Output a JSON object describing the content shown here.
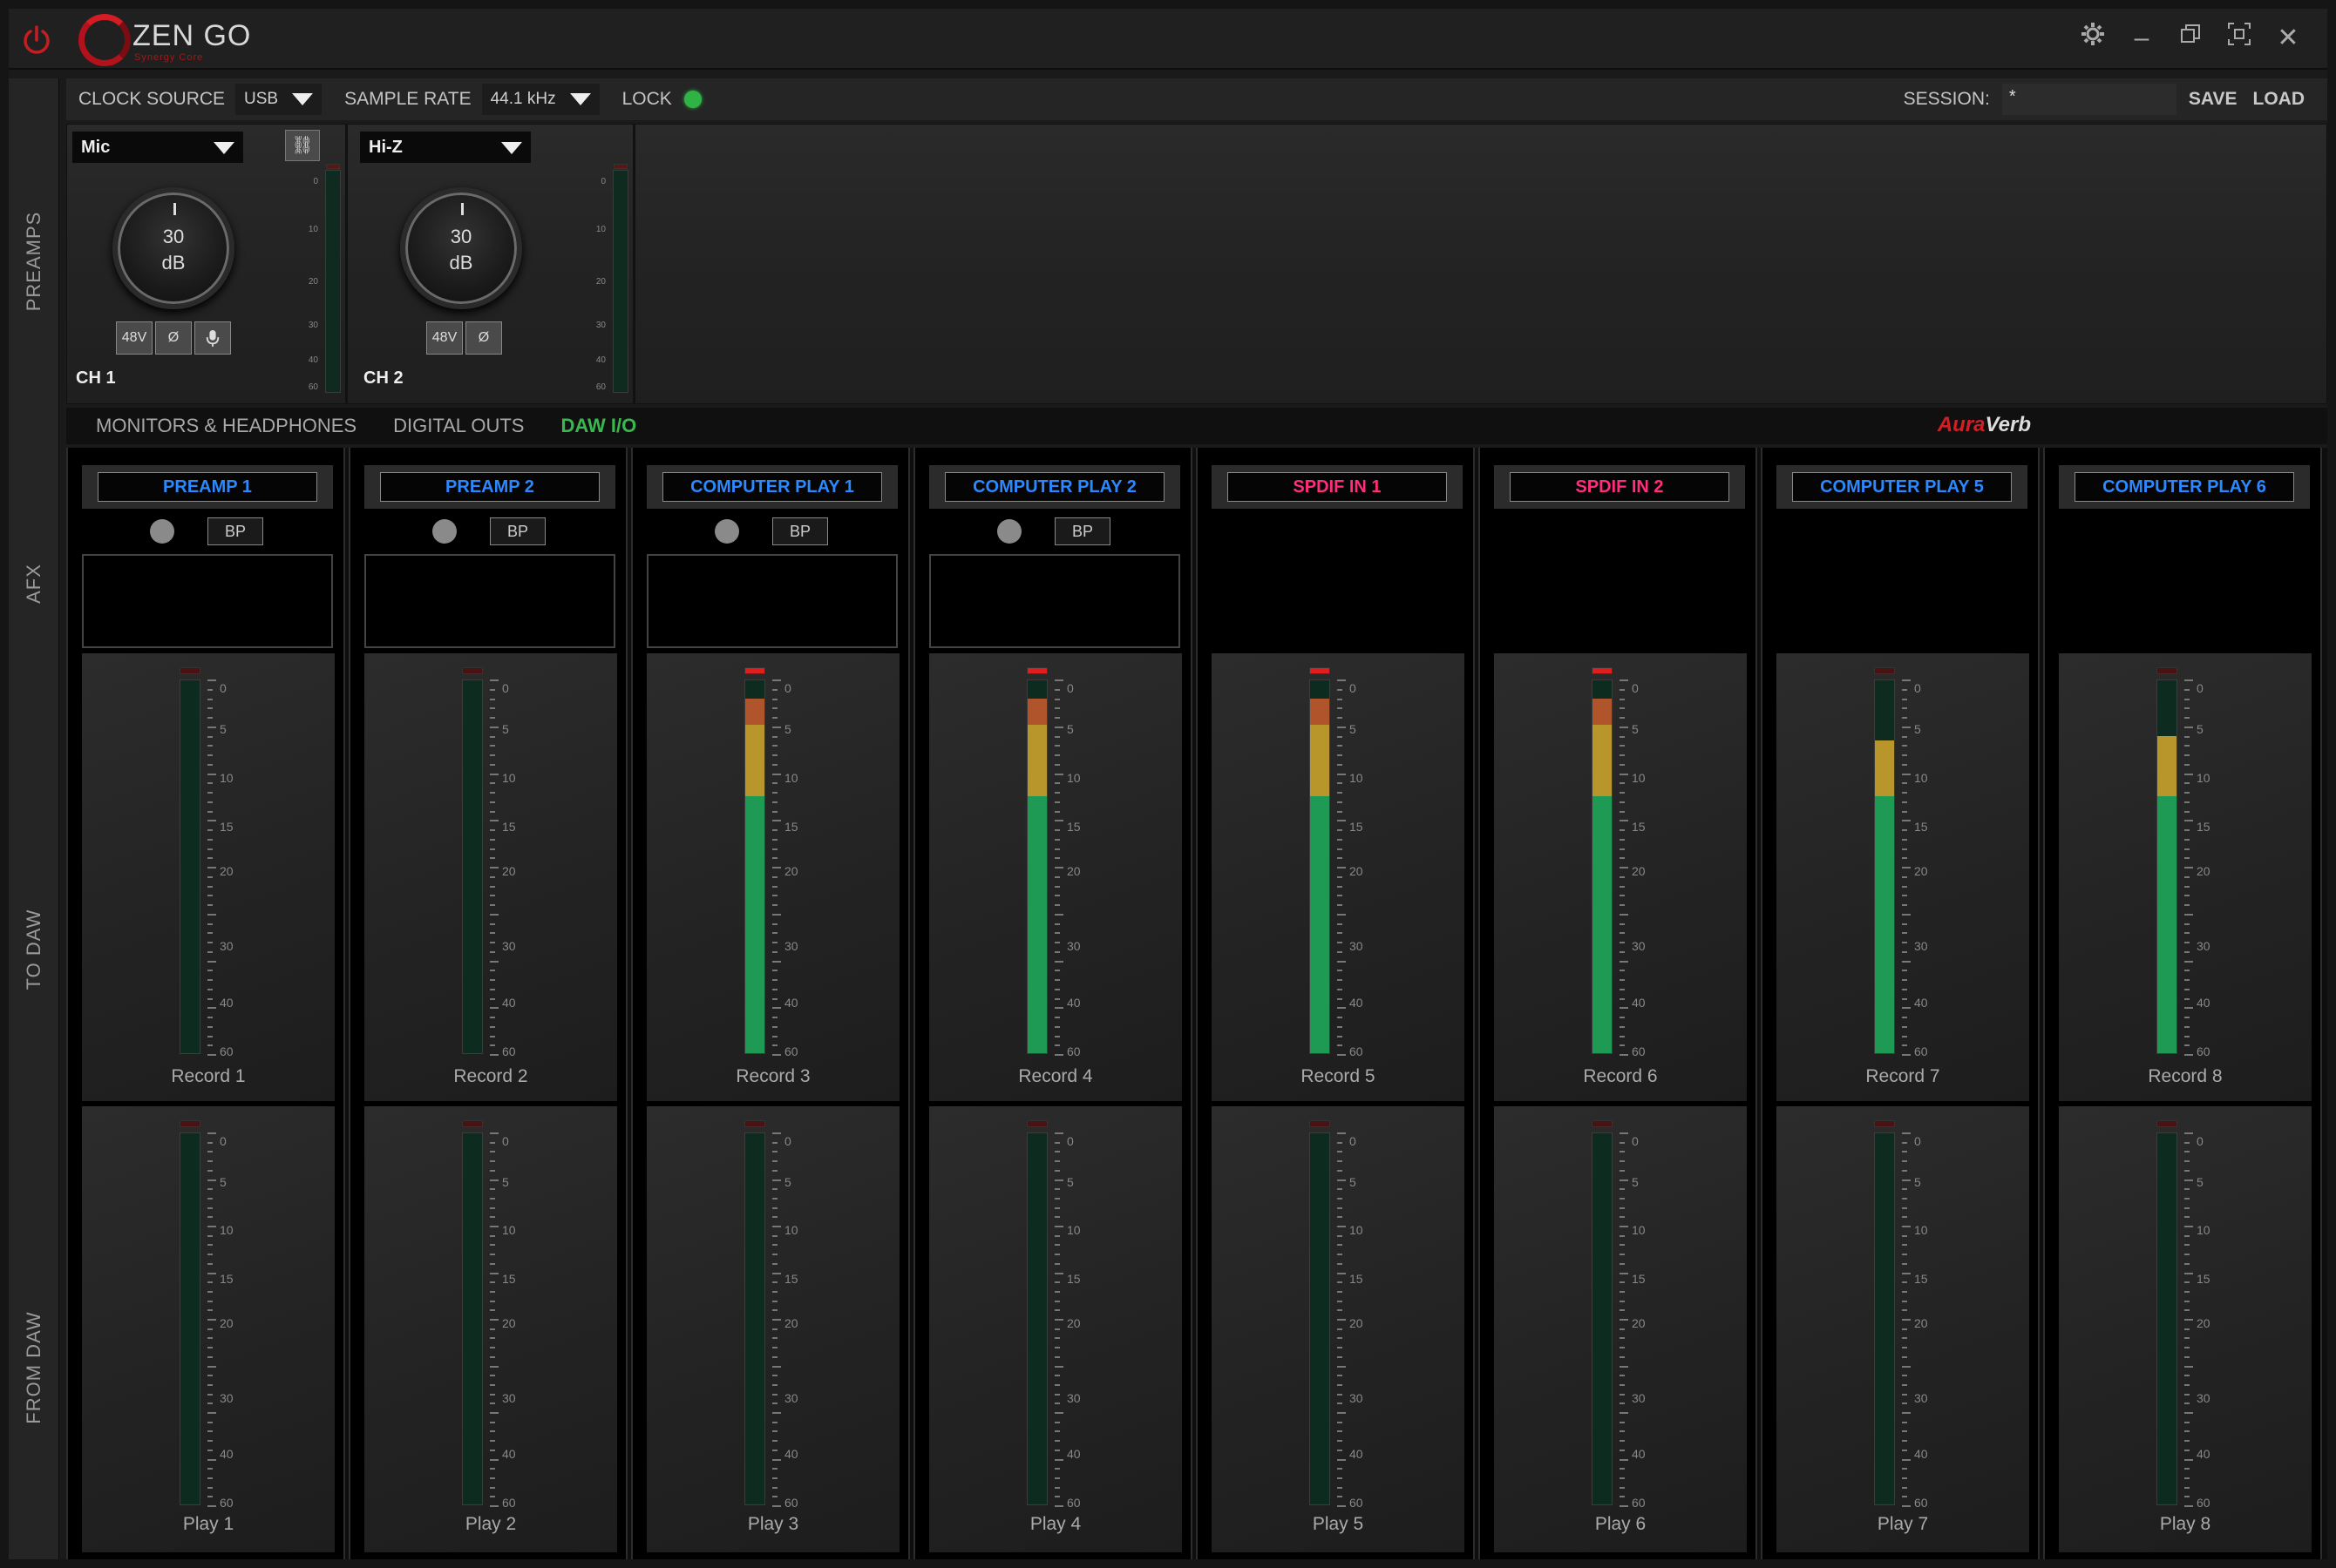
{
  "app": {
    "name": "ZEN GO",
    "subtitle": "Synergy Core"
  },
  "settings_bar": {
    "clock_source_label": "CLOCK SOURCE",
    "clock_source_value": "USB",
    "sample_rate_label": "SAMPLE  RATE",
    "sample_rate_value": "44.1 kHz",
    "lock_label": "LOCK",
    "lock_status_color": "#2fb344",
    "session_label": "SESSION:",
    "session_value": "*",
    "save_label": "SAVE",
    "load_label": "LOAD"
  },
  "side_tabs": [
    "PREAMPS",
    "AFX",
    "TO DAW",
    "FROM DAW"
  ],
  "preamps": [
    {
      "input_type": "Mic",
      "gain": "30",
      "unit": "dB",
      "buttons": [
        "48V",
        "Ø",
        "mic"
      ],
      "label": "CH 1"
    },
    {
      "input_type": "Hi-Z",
      "gain": "30",
      "unit": "dB",
      "buttons": [
        "48V",
        "Ø"
      ],
      "label": "CH 2"
    }
  ],
  "preamp_scale": [
    "0",
    "10",
    "20",
    "30",
    "40",
    "60"
  ],
  "tabs": [
    {
      "label": "MONITORS & HEADPHONES",
      "active": false
    },
    {
      "label": "DIGITAL OUTS",
      "active": false
    },
    {
      "label": "DAW I/O",
      "active": true
    }
  ],
  "auraverb": {
    "prefix": "Aura",
    "suffix": "Verb"
  },
  "meter_scale": [
    "0",
    "5",
    "10",
    "15",
    "20",
    "30",
    "40",
    "60"
  ],
  "channels": [
    {
      "name": "PREAMP 1",
      "color": "blue",
      "has_fx": true,
      "bp_label": "BP",
      "record_label": "Record 1",
      "record_level": 0,
      "record_clip": false,
      "play_label": "Play 1",
      "play_level": 0
    },
    {
      "name": "PREAMP 2",
      "color": "blue",
      "has_fx": true,
      "bp_label": "BP",
      "record_label": "Record 2",
      "record_level": 0,
      "record_clip": false,
      "play_label": "Play 2",
      "play_level": 0
    },
    {
      "name": "COMPUTER PLAY 1",
      "color": "blue",
      "has_fx": true,
      "bp_label": "BP",
      "record_label": "Record 3",
      "record_level": 0.95,
      "record_clip": true,
      "play_label": "Play 3",
      "play_level": 0
    },
    {
      "name": "COMPUTER PLAY 2",
      "color": "blue",
      "has_fx": true,
      "bp_label": "BP",
      "record_label": "Record 4",
      "record_level": 0.95,
      "record_clip": true,
      "play_label": "Play 4",
      "play_level": 0
    },
    {
      "name": "SPDIF IN 1",
      "color": "pink",
      "has_fx": false,
      "record_label": "Record 5",
      "record_level": 0.95,
      "record_clip": true,
      "play_label": "Play 5",
      "play_level": 0
    },
    {
      "name": "SPDIF IN 2",
      "color": "pink",
      "has_fx": false,
      "record_label": "Record 6",
      "record_level": 0.95,
      "record_clip": true,
      "play_label": "Play 6",
      "play_level": 0
    },
    {
      "name": "COMPUTER PLAY 5",
      "color": "blue",
      "has_fx": false,
      "record_label": "Record 7",
      "record_level": 0.84,
      "record_clip": false,
      "play_label": "Play 7",
      "play_level": 0
    },
    {
      "name": "COMPUTER PLAY 6",
      "color": "blue",
      "has_fx": false,
      "record_label": "Record 8",
      "record_level": 0.85,
      "record_clip": false,
      "play_label": "Play 8",
      "play_level": 0
    }
  ],
  "colors": {
    "meter_green": "#1f9a55",
    "meter_yellow": "#b8962c",
    "meter_orange": "#b0542c",
    "accent_red": "#d21f26",
    "active_tab": "#38b84f"
  }
}
